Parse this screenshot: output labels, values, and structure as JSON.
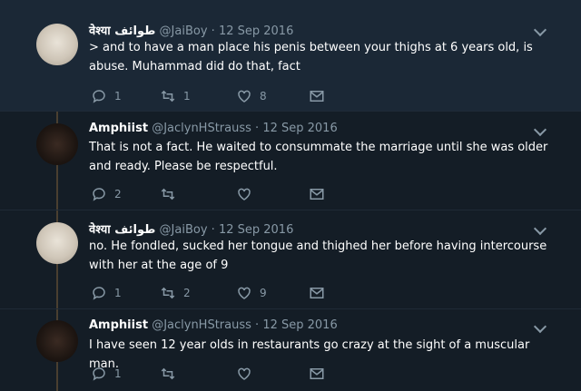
{
  "tweets": [
    {
      "display_name": "वेश्या طوائف",
      "handle": "@JaiBoy",
      "separator": "·",
      "date": "12 Sep 2016",
      "text": "> and to have a man place his penis between your thighs at 6 years old, is abuse. Muhammad did do that, fact",
      "replies": "1",
      "retweets": "1",
      "likes": "8"
    },
    {
      "display_name": "Amphiist",
      "handle": "@JaclynHStrauss",
      "separator": "·",
      "date": "12 Sep 2016",
      "text": "That is not a fact. He waited to consummate the marriage until she was older and ready. Please be respectful.",
      "replies": "2",
      "retweets": "",
      "likes": ""
    },
    {
      "display_name": "वेश्या طوائف",
      "handle": "@JaiBoy",
      "separator": "·",
      "date": "12 Sep 2016",
      "text": "no. He fondled, sucked her tongue and thighed her before having intercourse with her at the age of 9",
      "replies": "1",
      "retweets": "2",
      "likes": "9"
    },
    {
      "display_name": "Amphiist",
      "handle": "@JaclynHStrauss",
      "separator": "·",
      "date": "12 Sep 2016",
      "text": "I have seen 12 year olds in restaurants go crazy at the sight of a muscular man.",
      "replies": "1",
      "retweets": "",
      "likes": ""
    }
  ],
  "icons": {
    "reply": "reply-icon",
    "retweet": "retweet-icon",
    "like": "heart-icon",
    "message": "envelope-icon",
    "menu": "chevron-down-icon"
  },
  "colors": {
    "background": "#141d26",
    "highlight": "#1b2836",
    "text": "#ffffff",
    "muted": "#8899a6",
    "thread_line": "#4a3f30"
  }
}
